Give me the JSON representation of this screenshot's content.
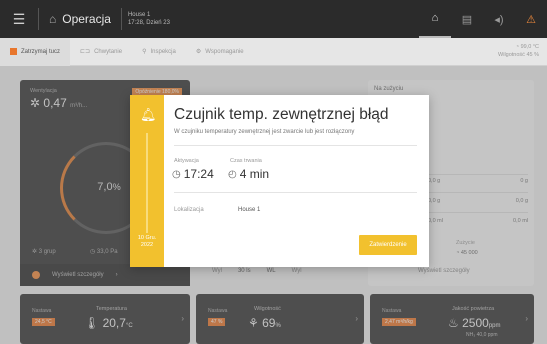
{
  "topbar": {
    "app_title": "Operacja",
    "house_name": "House 1",
    "house_time": "17:28, Dzień 23",
    "icons": [
      "menu-icon",
      "home-icon",
      "dashboard-icon",
      "document-icon",
      "signal-icon",
      "notifications-icon"
    ]
  },
  "subbar": {
    "stop_label": "Zatrzymaj tucz",
    "catch_label": "Chwytanie",
    "inspection_label": "Inspekcja",
    "help_label": "Wspomaganie",
    "temp_value": "99,0 °C",
    "humidity_value": "Wilgotność 45 %"
  },
  "dashboard": {
    "ventilation": {
      "title": "Wentylacja",
      "value": "0,47",
      "unit": "m³/h...",
      "badge": "Opóźnienie 180,0%",
      "gauge_value": "7,0",
      "gauge_unit": "%",
      "groups": "3 grup",
      "pressure": "33,0 Pa",
      "more_label": "Wyświetl szczegóły"
    },
    "right_card": {
      "title": "Na zużyciu",
      "rows": [
        {
          "a": "0,0 g",
          "b": "0 g"
        },
        {
          "a": "0,0 g",
          "b": "0,0 g"
        },
        {
          "a": "0,0 ml",
          "b": "0,0 ml"
        }
      ],
      "water_label": "Zużycie",
      "water_value": "45 000",
      "more_label": "Wyświetl szczegóły"
    },
    "tabs": [
      "Wyl",
      "30 ls",
      "WL",
      "Wyl"
    ],
    "bottom": [
      {
        "label": "Nastawa",
        "tag": "24,5 °C",
        "title": "Temperatura",
        "value": "20,7",
        "unit": "°C"
      },
      {
        "label": "Nastawa",
        "tag": "47 %",
        "title": "Wilgotność",
        "value": "69",
        "unit": "%"
      },
      {
        "label": "Nastawa",
        "tag": "2,47 m³/h/kg",
        "title": "Jakość powietrza",
        "value": "2500",
        "unit": "ppm",
        "sub": "NH₃ 40,0 ppm"
      }
    ]
  },
  "alarm": {
    "title": "Czujnik temp. zewnętrznej błąd",
    "description": "W czujniku temperatury zewnętrznej jest zwarcie lub jest rozłączony",
    "activation_label": "Aktywacja",
    "activation_value": "17:24",
    "duration_label": "Czas trwania",
    "duration_value": "4 min",
    "location_label": "Lokalizacja",
    "location_value": "House 1",
    "date_line1": "10 Gru.",
    "date_line2": "2022",
    "confirm_label": "Zatwierdzenie",
    "accent_color": "#f2c12e"
  }
}
